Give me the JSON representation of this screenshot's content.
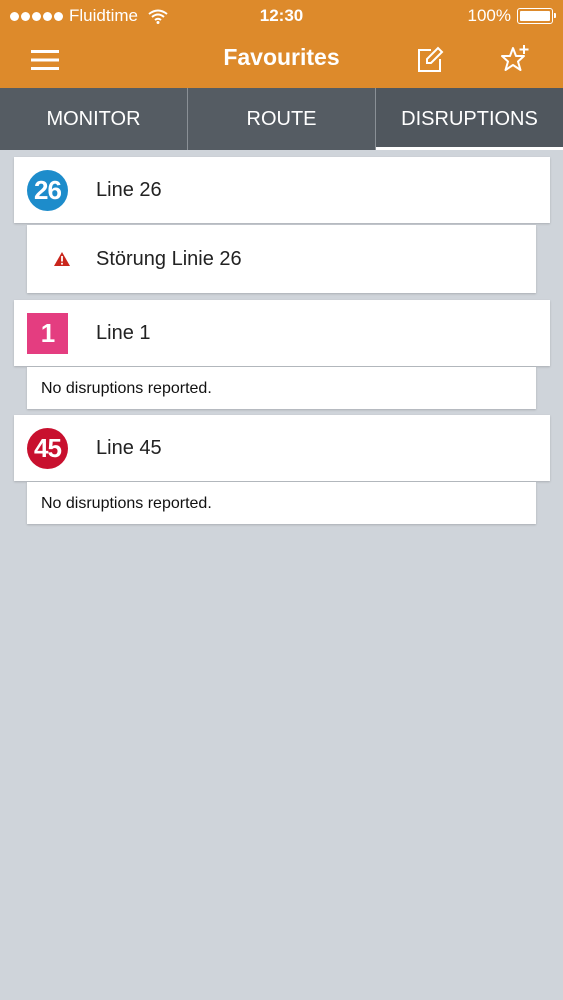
{
  "status_bar": {
    "carrier": "Fluidtime",
    "time": "12:30",
    "battery": "100%"
  },
  "navbar": {
    "title": "Favourites",
    "bg_color": "#dd8a2b",
    "icons": [
      "menu-icon",
      "edit-icon",
      "favourite-add-icon"
    ]
  },
  "tabs": [
    {
      "label": "MONITOR",
      "active": false
    },
    {
      "label": "ROUTE",
      "active": false
    },
    {
      "label": "DISRUPTIONS",
      "active": true
    }
  ],
  "lines": [
    {
      "badge": "26",
      "badge_color": "#1d8ccb",
      "badge_shape": "circle",
      "label": "Line 26",
      "disruptions": [
        {
          "title": "Störung Linie 26",
          "icon": "warning-icon"
        }
      ]
    },
    {
      "badge": "1",
      "badge_color": "#e43d80",
      "badge_shape": "square",
      "label": "Line 1",
      "no_disruptions": "No disruptions reported."
    },
    {
      "badge": "45",
      "badge_color": "#c8102e",
      "badge_shape": "circle",
      "label": "Line 45",
      "no_disruptions": "No disruptions reported."
    }
  ]
}
